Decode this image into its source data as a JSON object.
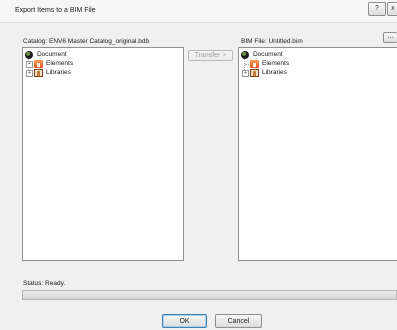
{
  "window": {
    "title": "Export Items to a BIM File",
    "help_glyph": "?",
    "close_glyph": "x"
  },
  "catalog_label": "Catalog: ENV6 Master Catalog_original.bdb",
  "bim_file_label": "BIM File: Untitled.bim",
  "browse_button": "...",
  "transfer_button": "Transfer >",
  "left_tree": [
    {
      "label": "Document",
      "icon": "document-icon",
      "expander": ""
    },
    {
      "label": "Elements",
      "icon": "elements-icon",
      "expander": "+"
    },
    {
      "label": "Libraries",
      "icon": "libraries-icon",
      "expander": "+"
    }
  ],
  "right_tree": [
    {
      "label": "Document",
      "icon": "document-icon",
      "expander": ""
    },
    {
      "label": "Elements",
      "icon": "elements-icon",
      "expander": ""
    },
    {
      "label": "Libraries",
      "icon": "libraries-icon",
      "expander": "+"
    }
  ],
  "status_text": "Status:  Ready.",
  "ok_button": "OK",
  "cancel_button": "Cancel"
}
